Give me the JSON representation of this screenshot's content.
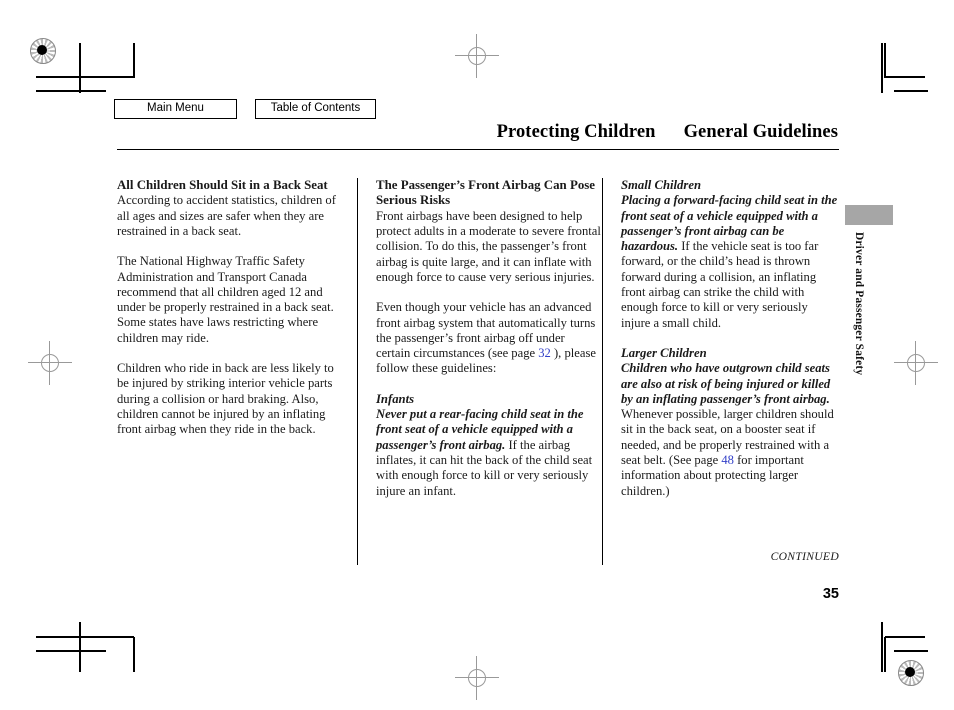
{
  "nav": {
    "main_menu_label": "Main Menu",
    "toc_label": "Table of Contents"
  },
  "header": {
    "section_title": "Protecting Children",
    "subsection_title": "General Guidelines"
  },
  "side_tab": {
    "label": "Driver and Passenger Safety"
  },
  "columns": {
    "col1": {
      "heading": "All Children Should Sit in a Back Seat",
      "para1": "According to accident statistics, children of all ages and sizes are safer when they are restrained in a back seat.",
      "para2": "The National Highway Traffic Safety Administration and Transport Canada recommend that all children aged 12 and under be properly restrained in a back seat. Some states have laws restricting where children may ride.",
      "para3": "Children who ride in back are less likely to be injured by striking interior vehicle parts during a collision or hard braking. Also, children cannot be injured by an inflating front airbag when they ride in the back."
    },
    "col2": {
      "heading": "The Passenger’s Front Airbag Can Pose Serious Risks",
      "para1": "Front airbags have been designed to help protect adults in a moderate to severe frontal collision. To do this, the passenger’s front airbag is quite large, and it can inflate with enough force to cause very serious injuries.",
      "para2_before_link": "Even though your vehicle has an advanced front airbag system that automatically turns the passenger’s front airbag off under certain circumstances (see page ",
      "para2_link": "32",
      "para2_after_link": " ), please follow these guidelines:",
      "subheading": "Infants",
      "para3_lead": "Never put a rear-facing child seat in the front seat of a vehicle equipped with a passenger’s front airbag.",
      "para3_rest": " If the airbag inflates, it can hit the back of the child seat with enough force to kill or very seriously injure an infant."
    },
    "col3": {
      "subheading1": "Small Children",
      "para1_lead": "Placing a forward-facing child seat in the front seat of a vehicle equipped with a passenger’s front airbag can be hazardous.",
      "para1_rest": " If the vehicle seat is too far forward, or the child’s head is thrown forward during a collision, an inflating front airbag can strike the child with enough force to kill or very seriously injure a small child.",
      "subheading2": "Larger Children",
      "para2_lead": "Children who have outgrown child seats are also at risk of being injured or killed by an inflating passenger’s front airbag.",
      "para2_rest_before_link": " Whenever possible, larger children should sit in the back seat, on a booster seat if needed, and be properly restrained with a seat belt. (See page ",
      "para2_link": "48",
      "para2_rest_after_link": " for important information about protecting larger children.)"
    }
  },
  "footer": {
    "continued_label": "CONTINUED",
    "page_number": "35"
  },
  "colors": {
    "link_blue": "#3340c8",
    "tab_gray": "#a6a6a6"
  }
}
